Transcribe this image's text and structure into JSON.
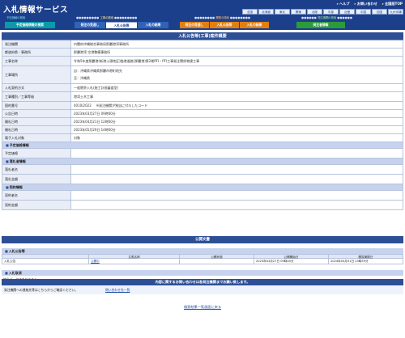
{
  "header": {
    "site_title": "入札情報サービス",
    "util_links": [
      "ヘルプ",
      "お問い合わせ",
      "全国版TOP"
    ],
    "regions": [
      "全国",
      "北海道",
      "東北",
      "関東",
      "北陸",
      "中部",
      "近畿",
      "中国",
      "四国",
      "九州沖縄"
    ],
    "section_labels": {
      "bid_info": "工事の検索",
      "target_info": "業務の検索",
      "orderer_info": "発注機関の検索",
      "left_group": "予定価格の検索"
    },
    "tabs": [
      {
        "label": "予定価格情報の検索",
        "style": "cyan"
      },
      {
        "label": "発注の見通し",
        "style": "blue"
      },
      {
        "label": "入札公告等",
        "style": "active"
      },
      {
        "label": "入札の結果",
        "style": "blue"
      },
      {
        "label": "発注の見通し",
        "style": "orange"
      },
      {
        "label": "入札公告等",
        "style": "orange"
      },
      {
        "label": "入札の結果",
        "style": "orange"
      },
      {
        "label": "発注者情報",
        "style": "green"
      }
    ]
  },
  "detail": {
    "title": "入札公告等(工事)案件概要",
    "fields": {
      "orderer": {
        "label": "発注機関",
        "value": "内閣府沖縄総合事務局那覇港湾事務所"
      },
      "prefecture": {
        "label": "都道府県・事務所",
        "value": "那覇港湾 空港整備事務所"
      },
      "project_name": {
        "label": "工事名称",
        "value": "令和5年度那覇港(新港ふ頭地区)臨港道路(那覇港)第2期PFI・PFI工事発注関係物建工事"
      },
      "location": {
        "label": "工事場所",
        "value1": "自：沖縄県沖縄県那覇市港町地先",
        "value2": "至：沖縄県"
      },
      "bid_method": {
        "label": "入札契約方式",
        "value": "一般競争入札(施工計画審査型)"
      },
      "category": {
        "label": "工事種別／工事等級",
        "value": "港湾土木工事"
      },
      "notice_no": {
        "label": "国的番号",
        "value": "4010/2023",
        "note": "※発注機関が独自に付与したコード"
      },
      "notice_date": {
        "label": "公告日時",
        "value": "2023年03月27日 09時00分"
      },
      "deadline": {
        "label": "開札日時",
        "value": "2023年04月21日 12時00分"
      },
      "open_date": {
        "label": "開札日時",
        "value": "2023年05月29日 14時00分"
      },
      "e_bid": {
        "label": "電子入札対象",
        "value": "対象"
      }
    },
    "sections": {
      "estimate": "予定価格情報",
      "estimate_price": "予定価格",
      "bidder": "落札者情報",
      "bidder_name": "落札者名",
      "bid_amount": "落札金額",
      "contract": "契約情報",
      "contractor": "契約者名",
      "contract_amount": "契約金額"
    }
  },
  "docs": {
    "title": "公開文書",
    "subsection": "入札公告等",
    "headers": [
      "文書名称",
      "公開状態",
      "公開開始日",
      "閲覧期限日"
    ],
    "rows": [
      {
        "type": "入札公告",
        "name": "公開中",
        "status": "",
        "start": "2023年03月27日 09時00分",
        "end": "2024年03月31日 23時59分"
      }
    ],
    "cancel_subsection": "入札取消",
    "cancel_text": "該当データはありません"
  },
  "inquiry": {
    "bar": "内容に関するお問い合わせは各発注機関までお願い致します。",
    "label": "発注機関への連絡先等はこちらからご確認ください。",
    "link": "問い合わせ先一覧"
  },
  "footer": {
    "back_link": "検索結果一覧画面に戻る"
  }
}
